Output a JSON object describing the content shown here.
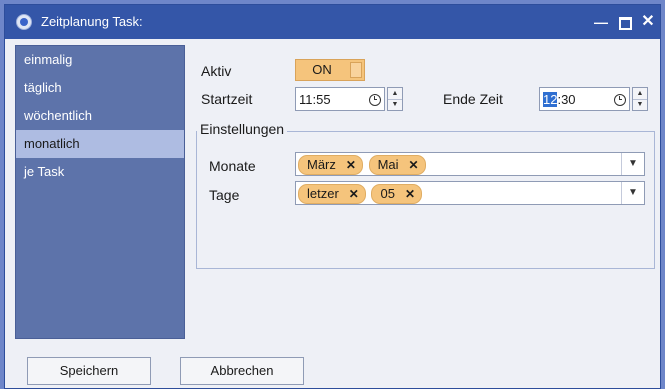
{
  "window": {
    "title": "Zeitplanung Task:",
    "controls": {
      "minimize": "—",
      "close": "✕"
    }
  },
  "sidebar": {
    "items": [
      {
        "label": "einmalig",
        "active": false
      },
      {
        "label": "täglich",
        "active": false
      },
      {
        "label": "wöchentlich",
        "active": false
      },
      {
        "label": "monatlich",
        "active": true
      },
      {
        "label": "je Task",
        "active": false
      }
    ]
  },
  "form": {
    "aktiv_label": "Aktiv",
    "toggle_value": "ON",
    "startzeit_label": "Startzeit",
    "startzeit_value": "11:55",
    "endzeit_label": "Ende Zeit",
    "endzeit_selected": "12",
    "endzeit_rest": ":30",
    "group_title": "Einstellungen",
    "monate_label": "Monate",
    "monate_chips": [
      "März",
      "Mai"
    ],
    "tage_label": "Tage",
    "tage_chips": [
      "letzer",
      "05"
    ],
    "chip_remove_glyph": "✕",
    "dropdown_glyph": "▼",
    "spin_up_glyph": "▲",
    "spin_down_glyph": "▼"
  },
  "buttons": {
    "save": "Speichern",
    "cancel": "Abbrechen"
  },
  "colors": {
    "titlebar": "#3456a8",
    "sidebar": "#5d73aa",
    "sidebar_active": "#aebce2",
    "accent_orange": "#f5c47c",
    "selection": "#2f6fd1"
  }
}
